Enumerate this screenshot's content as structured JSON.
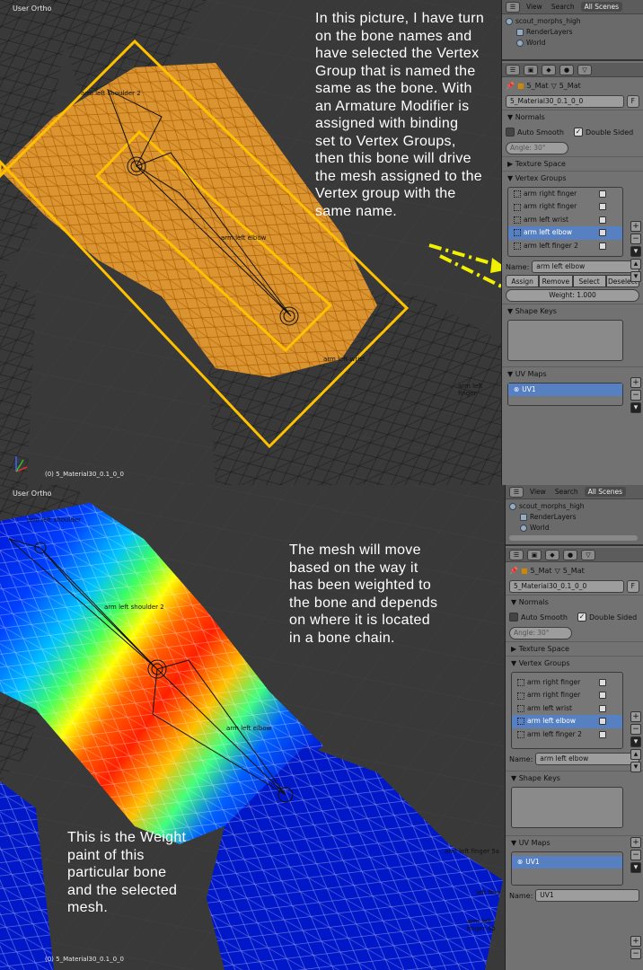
{
  "top": {
    "viewport_title": "User Ortho",
    "status": "(0) 5_Material30_0.1_0_0",
    "annotation": "In this picture, I have turn\non the bone names and\nhave selected the Vertex\nGroup that is named the\nsame as the bone.  With\nan Armature Modifier is\nassigned with binding\nset to Vertex Groups,\nthen this bone will drive\nthe mesh assigned to the\nVertex group with the\nsame name.",
    "bone_labels": [
      "arm left shoulder 2",
      "arm left elbow",
      "arm left wrist",
      "arm left finger"
    ]
  },
  "bottom": {
    "viewport_title": "User Ortho",
    "status": "(0) 5_Material30_0.1_0_0",
    "annotation": "The mesh will move\nbased on the way it\nhas been weighted to\nthe bone and depends\non where it is located\nin a bone chain.",
    "annotation2": "This is the Weight\npaint of this\nparticular bone\nand the selected\nmesh.",
    "bone_labels": [
      "arm left shoulder",
      "arm left shoulder 2",
      "arm left elbow",
      "arm left finger 5a",
      "arm left finger 4b",
      "left fing"
    ]
  },
  "panel": {
    "menu_view": "View",
    "menu_search": "Search",
    "scenes": "All Scenes",
    "tree": [
      "scout_morphs_high",
      "RenderLayers",
      "World"
    ],
    "breadcrumb_obj": "5_Mat",
    "breadcrumb_data": "5_Mat",
    "mesh_name": "5_Material30_0.1_0_0",
    "mesh_flag": "F",
    "normals": "Normals",
    "auto_smooth": "Auto Smooth",
    "double_sided": "Double Sided",
    "angle": "Angle: 30°",
    "texture_space": "Texture Space",
    "vertex_groups": "Vertex Groups",
    "groups": [
      "arm right finger",
      "arm right finger",
      "arm left wrist",
      "arm left elbow",
      "arm left finger 2"
    ],
    "name_label": "Name:",
    "name_value": "arm left elbow",
    "assign": "Assign",
    "remove": "Remove",
    "select": "Select",
    "deselect": "Deselect",
    "weight": "Weight: 1.000",
    "shape_keys": "Shape Keys",
    "uv_maps": "UV Maps",
    "uv1": "UV1",
    "uv_name_label": "Name:",
    "uv_name_value": "UV1"
  },
  "colors": {
    "orange": "#f0a030",
    "selection": "#ffc000",
    "arrow": "#f0f000",
    "list_selected": "#5680c2"
  }
}
